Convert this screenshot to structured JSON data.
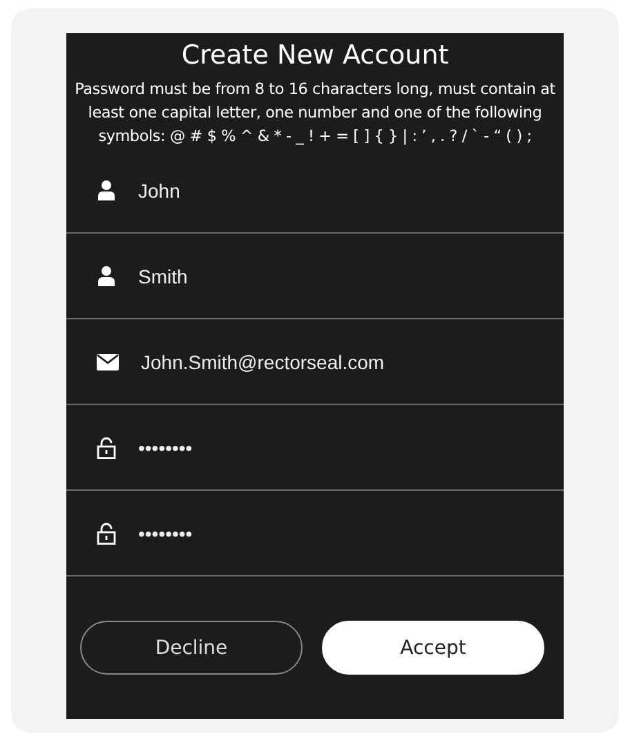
{
  "title": "Create New Account",
  "instructions": "Password must be from 8 to 16 characters long, must contain at least one capital letter, one number and one of the following symbols: @ # $ % ^ & * - _ ! + = [ ] { } | : ’ , . ? / ` - “ ( ) ;",
  "fields": [
    {
      "kind": "person",
      "value": "John"
    },
    {
      "kind": "person",
      "value": "Smith"
    },
    {
      "kind": "email",
      "value": "John.Smith@rectorseal.com"
    },
    {
      "kind": "password",
      "value": "••••••••"
    },
    {
      "kind": "password",
      "value": "••••••••"
    }
  ],
  "buttons": [
    {
      "label": "Decline",
      "kind": "secondary"
    },
    {
      "label": "Accept",
      "kind": "primary"
    }
  ]
}
